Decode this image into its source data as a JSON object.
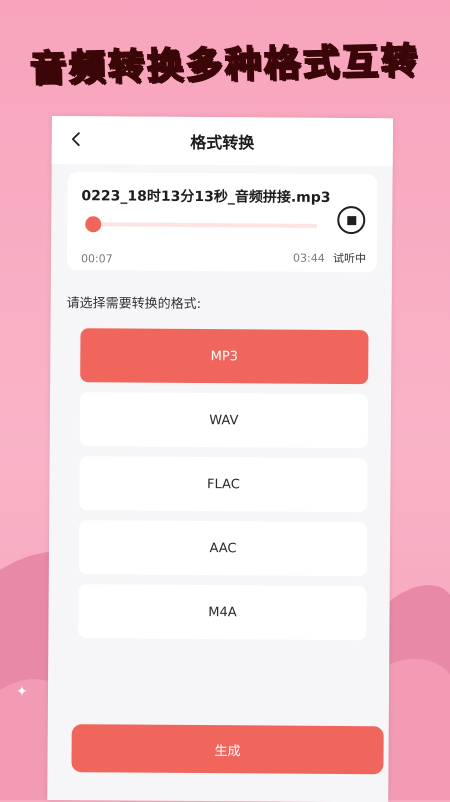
{
  "banner": {
    "text": "音频转换多种格式互转"
  },
  "nav": {
    "title": "格式转换",
    "back_icon": "chevron-left-icon"
  },
  "player": {
    "filename": "0223_18时13分13秒_音频拼接.mp3",
    "current_time": "00:07",
    "total_time": "03:44",
    "progress": 0.03,
    "stop_icon": "stop-circle-icon",
    "status_label": "试听中"
  },
  "prompt": "请选择需要转换的格式:",
  "formats": [
    {
      "label": "MP3",
      "selected": true
    },
    {
      "label": "WAV",
      "selected": false
    },
    {
      "label": "FLAC",
      "selected": false
    },
    {
      "label": "AAC",
      "selected": false
    },
    {
      "label": "M4A",
      "selected": false
    }
  ],
  "generate_label": "生成",
  "colors": {
    "accent": "#f0665c",
    "background": "#f7a9c0",
    "banner": "#e1142b"
  }
}
